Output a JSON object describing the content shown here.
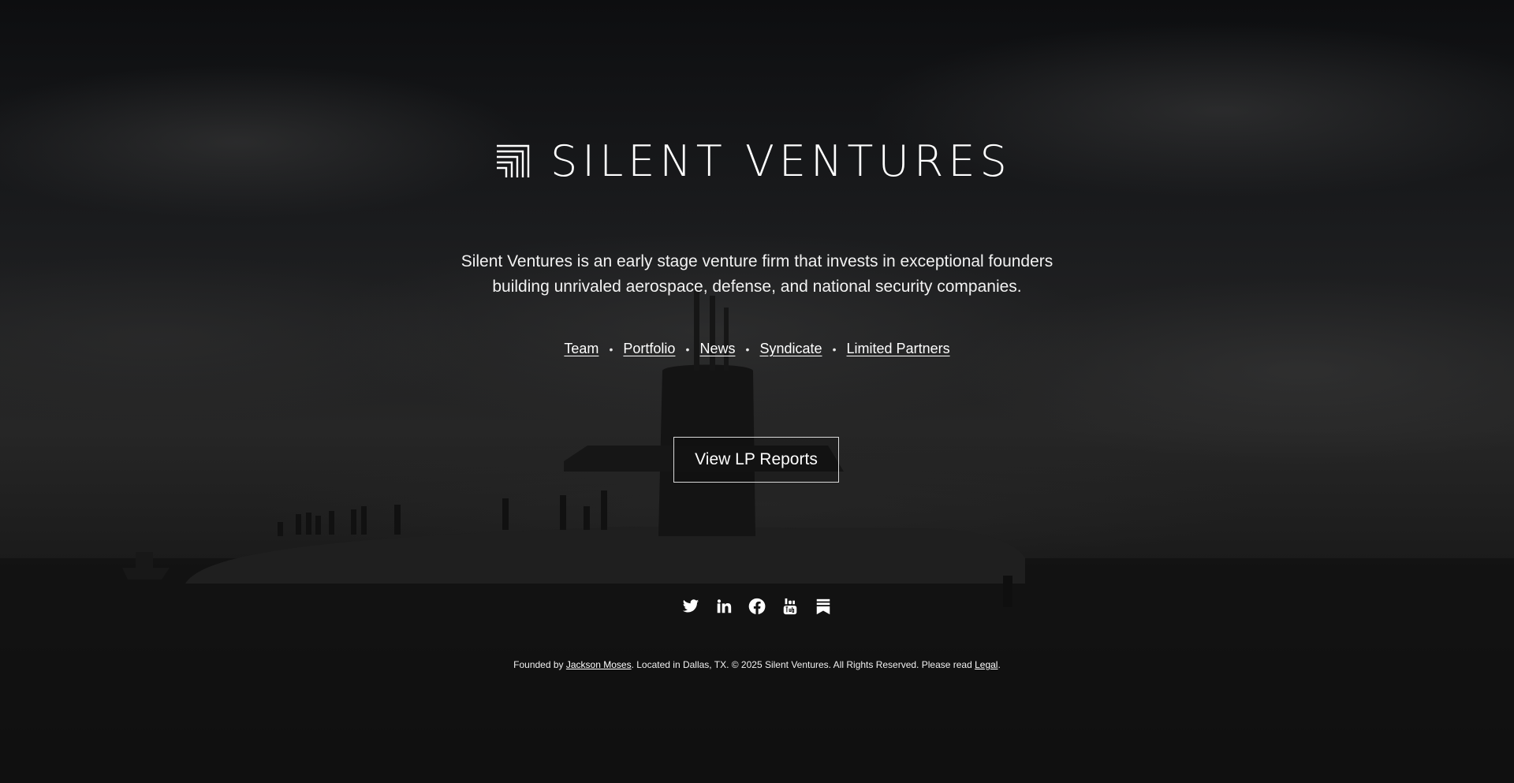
{
  "brand": {
    "name": "SILENT VENTURES",
    "logo_icon": "stacked-lines-logo-icon"
  },
  "tagline": {
    "line1": "Silent Ventures is an early stage venture firm that invests in exceptional founders",
    "line2": "building unrivaled aerospace, defense, and national security companies."
  },
  "nav": {
    "separator": "•",
    "items": [
      {
        "label": "Team"
      },
      {
        "label": "Portfolio"
      },
      {
        "label": "News"
      },
      {
        "label": "Syndicate"
      },
      {
        "label": "Limited Partners"
      }
    ]
  },
  "cta": {
    "label": "View LP Reports"
  },
  "social": {
    "icons": [
      "twitter-icon",
      "linkedin-icon",
      "facebook-icon",
      "youtube-icon",
      "substack-icon"
    ]
  },
  "footer": {
    "prefix": "Founded by ",
    "founder_link": "Jackson Moses",
    "middle": ". Located in Dallas, TX. © 2025 Silent Ventures. All Rights Reserved. Please read ",
    "legal_link": "Legal",
    "suffix": "."
  },
  "colors": {
    "background": "#0b0c0d",
    "text": "#ffffff",
    "button_border": "#d9d9d9"
  }
}
